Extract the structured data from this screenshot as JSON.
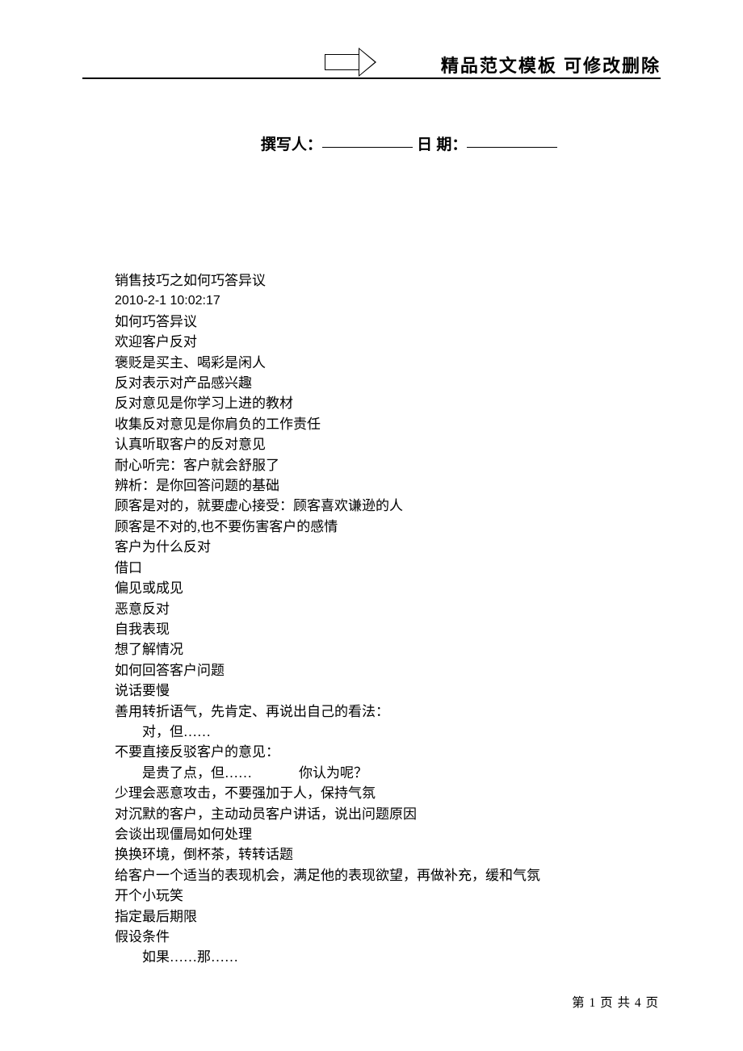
{
  "header": {
    "title": "精品范文模板  可修改删除"
  },
  "author_line": {
    "label_author": "撰写人：",
    "label_date": "日  期："
  },
  "body": {
    "lines": [
      "销售技巧之如何巧答异议",
      "2010-2-1 10:02:17",
      "  如何巧答异议",
      "欢迎客户反对",
      "褒贬是买主、喝彩是闲人",
      "反对表示对产品感兴趣",
      "反对意见是你学习上进的教材",
      "收集反对意见是你肩负的工作责任",
      "认真听取客户的反对意见",
      "耐心听完：客户就会舒服了",
      "辨析：是你回答问题的基础",
      "顾客是对的，就要虚心接受：顾客喜欢谦逊的人",
      "顾客是不对的,也不要伤害客户的感情",
      "客户为什么反对",
      "借口",
      "偏见或成见",
      "恶意反对",
      "自我表现",
      "想了解情况",
      "如何回答客户问题",
      "说话要慢",
      "善用转折语气，先肯定、再说出自己的看法：",
      "对，但……",
      "不要直接反驳客户的意见：",
      "是贵了点，但……",
      "你认为呢？",
      "少理会恶意攻击，不要强加于人，保持气氛",
      "对沉默的客户，主动动员客户讲话，说出问题原因",
      "会谈出现僵局如何处理",
      "换换环境，倒杯茶，转转话题",
      "给客户一个适当的表现机会，满足他的表现欲望，再做补充，缓和气氛",
      "开个小玩笑",
      "指定最后期限",
      "假设条件",
      "如果……那……"
    ]
  },
  "footer": {
    "page_label": "第 1 页 共 4 页"
  }
}
